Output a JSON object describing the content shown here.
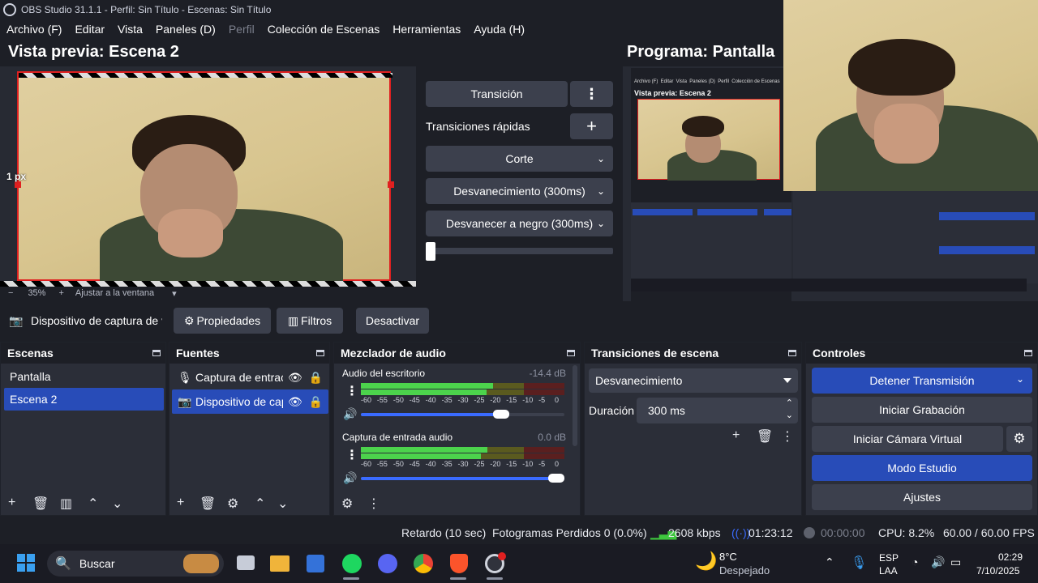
{
  "window": {
    "title": "OBS Studio 31.1.1 - Perfil: Sin Título - Escenas: Sin Título"
  },
  "menu": {
    "items": [
      "Archivo (F)",
      "Editar",
      "Vista",
      "Paneles (D)",
      "Perfil",
      "Colección de Escenas",
      "Herramientas",
      "Ayuda (H)"
    ]
  },
  "preview": {
    "label": "Vista previa: Escena 2",
    "px_label": "1 px",
    "zoom": "35%",
    "fit_label": "Ajustar a la ventana"
  },
  "program": {
    "label": "Programa: Pantalla"
  },
  "transitions_panel": {
    "transition_button": "Transición",
    "quick_label": "Transiciones rápidas",
    "quick": [
      "Corte",
      "Desvanecimiento (300ms)",
      "Desvanecer a negro (300ms)"
    ]
  },
  "source_toolbar": {
    "source_name": "Dispositivo de captura de v",
    "properties": "Propiedades",
    "filters": "Filtros",
    "deactivate": "Desactivar"
  },
  "scenes": {
    "title": "Escenas",
    "items": [
      "Pantalla",
      "Escena 2"
    ],
    "selected": 1
  },
  "sources": {
    "title": "Fuentes",
    "items": [
      "Captura de entrac",
      "Dispositivo de cap"
    ],
    "selected": 1
  },
  "mixer": {
    "title": "Mezclador de audio",
    "channels": [
      {
        "name": "Audio del escritorio",
        "db": "-14.4 dB",
        "level": 0.73
      },
      {
        "name": "Captura de entrada audio",
        "db": "0.0 dB",
        "level": 1.0
      }
    ],
    "ticks": [
      "-60",
      "-55",
      "-50",
      "-45",
      "-40",
      "-35",
      "-30",
      "-25",
      "-20",
      "-15",
      "-10",
      "-5",
      "0"
    ]
  },
  "scene_transitions": {
    "title": "Transiciones de escena",
    "selected": "Desvanecimiento",
    "duration_label": "Duración",
    "duration": "300 ms"
  },
  "controls": {
    "title": "Controles",
    "stop_stream": "Detener Transmisión",
    "start_rec": "Iniciar Grabación",
    "start_vcam": "Iniciar Cámara Virtual",
    "studio_mode": "Modo Estudio",
    "settings": "Ajustes"
  },
  "status": {
    "delay": "Retardo (10 sec)",
    "dropped": "Fotogramas Perdidos 0 (0.0%)",
    "kbps": "2608 kbps",
    "stream_time": "01:23:12",
    "rec_time": "00:00:00",
    "cpu": "CPU: 8.2%",
    "fps": "60.00 / 60.00 FPS"
  },
  "taskbar": {
    "search": "Buscar",
    "weather_temp": "8°C",
    "weather_desc": "Despejado",
    "lang1": "ESP",
    "lang2": "LAA",
    "time": "02:29",
    "date": "7/10/2025"
  },
  "colors": {
    "accent": "#284cb8",
    "panel": "#2b2e38",
    "bg": "#1d1f26"
  }
}
